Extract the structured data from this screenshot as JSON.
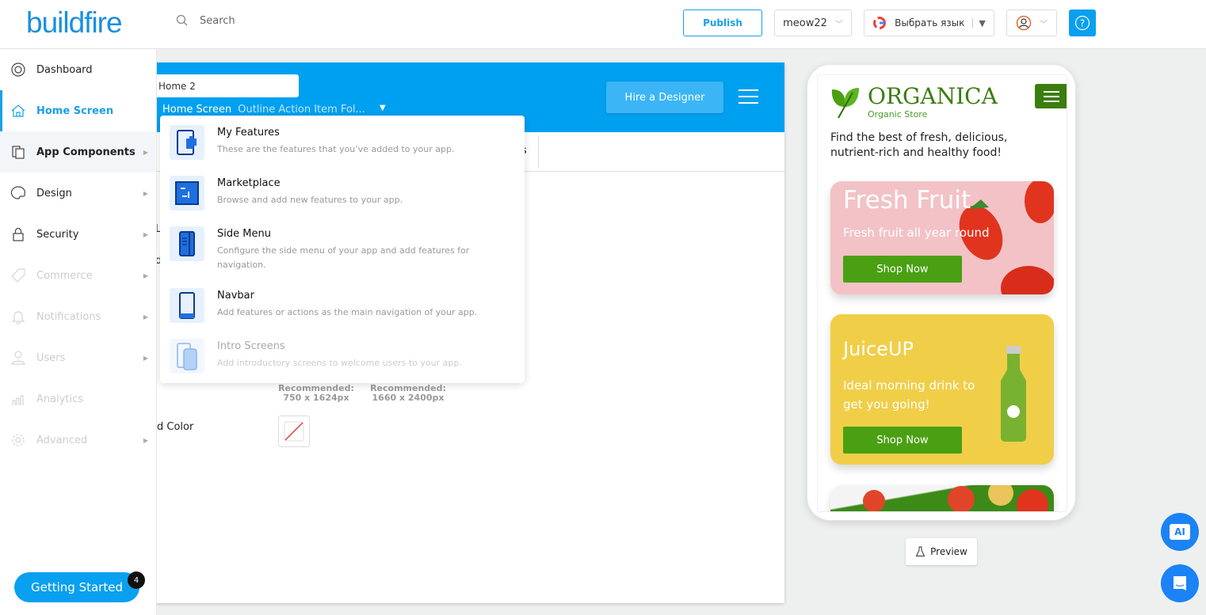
{
  "header": {
    "logo": "buildfire",
    "search_placeholder": "Search",
    "publish": "Publish",
    "app_select": "meow22",
    "language": "Выбрать язык",
    "accent": "#00a0f0"
  },
  "sidebar": {
    "items": [
      {
        "label": "Dashboard",
        "icon": "lifebuoy-icon",
        "state": "normal"
      },
      {
        "label": "Home Screen",
        "icon": "home-icon",
        "state": "active"
      },
      {
        "label": "App Components",
        "icon": "components-icon",
        "state": "hover"
      },
      {
        "label": "Design",
        "icon": "palette-icon",
        "state": "normal"
      },
      {
        "label": "Security",
        "icon": "lock-icon",
        "state": "normal"
      },
      {
        "label": "Commerce",
        "icon": "tag-icon",
        "state": "disabled"
      },
      {
        "label": "Notifications",
        "icon": "bell-icon",
        "state": "disabled"
      },
      {
        "label": "Users",
        "icon": "user-icon",
        "state": "disabled"
      },
      {
        "label": "Analytics",
        "icon": "chart-icon",
        "state": "disabled"
      },
      {
        "label": "Advanced",
        "icon": "gear-icon",
        "state": "disabled"
      }
    ],
    "getting_started": "Getting Started",
    "getting_started_badge": "4"
  },
  "editor": {
    "screen_name": "Home 2",
    "breadcrumb": {
      "root": "Home Screen",
      "current": "Outline Action Item Fol..."
    },
    "hire_designer": "Hire a Designer",
    "fragments": {
      "l": "L",
      "d": "d",
      "color_label": "d Color",
      "tab_s": "s"
    },
    "recommended": [
      {
        "label": "Recommended:",
        "size": "750 x 1624px"
      },
      {
        "label": "Recommended:",
        "size": "1660 x 2400px"
      }
    ]
  },
  "dropdown": {
    "items": [
      {
        "title": "My Features",
        "desc": "These are the features that you’ve added to your app.",
        "disabled": false
      },
      {
        "title": "Marketplace",
        "desc": "Browse and add new features to your app.",
        "disabled": false
      },
      {
        "title": "Side Menu",
        "desc": "Configure the side menu of your app and add features for navigation.",
        "disabled": false
      },
      {
        "title": "Navbar",
        "desc": "Add features or actions as the main navigation of your app.",
        "disabled": false
      },
      {
        "title": "Intro Screens",
        "desc": "Add introductory screens to welcome users to your app.",
        "disabled": true
      }
    ]
  },
  "phone": {
    "brand": "ORGANICA",
    "brand_sub": "Organic Store",
    "tagline": "Find the best of fresh, delicious, nutrient-rich and healthy food!",
    "cards": [
      {
        "title": "Fresh Fruit",
        "subtitle": "Fresh fruit all year round",
        "button": "Shop Now",
        "bg": "#f2c2c6"
      },
      {
        "title": "JuiceUP",
        "subtitle": "Ideal morning drink to get you going!",
        "button": "Shop Now",
        "bg": "#f0ce48"
      }
    ]
  },
  "preview": "Preview",
  "ai_label": "AI"
}
